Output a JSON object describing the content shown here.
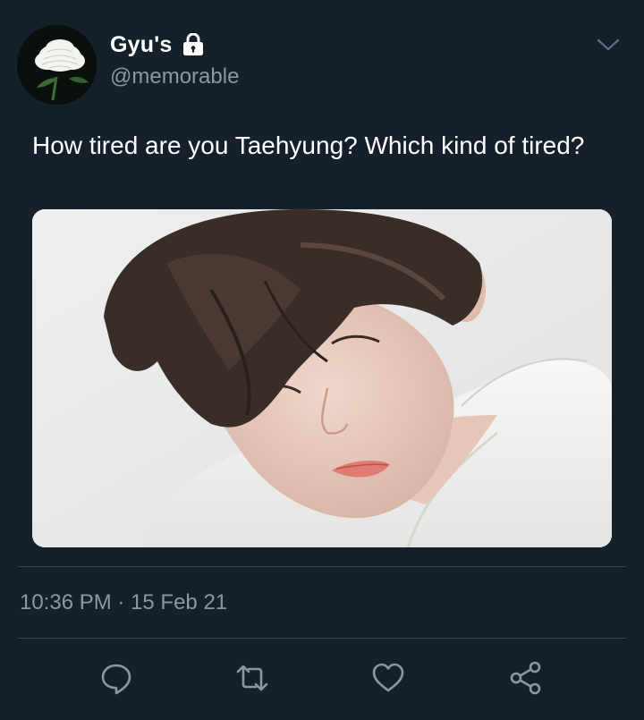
{
  "author": {
    "display_name": "Gyu's",
    "handle": "@memorable",
    "protected": true,
    "avatar_icon": "white-chrysanthemum-avatar"
  },
  "tweet": {
    "text": "How tired are you Taehyung? Which kind of tired?",
    "timestamp": "10:36 PM · 15 Feb 21",
    "media_alt": "photo-of-person-in-white-shirt"
  },
  "actions": [
    {
      "name": "reply",
      "icon": "reply-icon"
    },
    {
      "name": "retweet",
      "icon": "retweet-icon"
    },
    {
      "name": "like",
      "icon": "heart-icon"
    },
    {
      "name": "share",
      "icon": "share-icon"
    }
  ],
  "colors": {
    "background": "#15202b",
    "text_primary": "#ffffff",
    "text_secondary": "#8899a6",
    "divider": "#38444d",
    "icon": "#8899a6"
  }
}
